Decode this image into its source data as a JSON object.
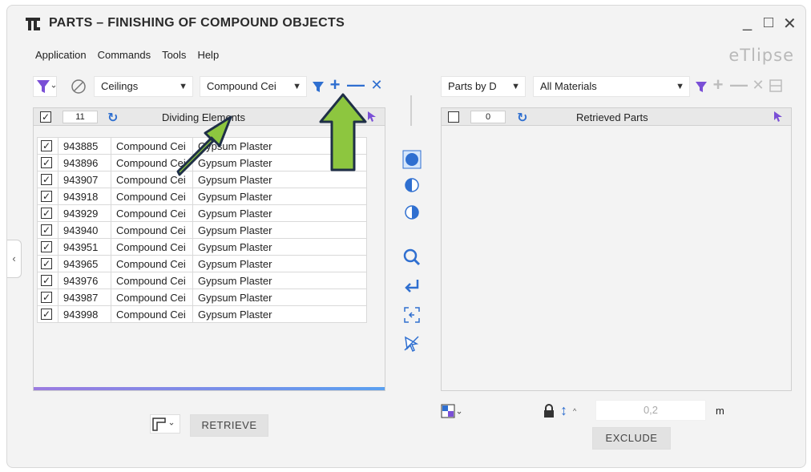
{
  "window": {
    "title": "PARTS – FINISHING OF COMPOUND OBJECTS",
    "brand": "eTlipse"
  },
  "menu": [
    "Application",
    "Commands",
    "Tools",
    "Help"
  ],
  "left": {
    "category": "Ceilings",
    "type_filter": "Compound Cei",
    "header": {
      "count": "11",
      "title": "Dividing Elements"
    },
    "rows": [
      {
        "id": "943885",
        "type": "Compound Cei",
        "material": "Gypsum Plaster"
      },
      {
        "id": "943896",
        "type": "Compound Cei",
        "material": "Gypsum Plaster"
      },
      {
        "id": "943907",
        "type": "Compound Cei",
        "material": "Gypsum Plaster"
      },
      {
        "id": "943918",
        "type": "Compound Cei",
        "material": "Gypsum Plaster"
      },
      {
        "id": "943929",
        "type": "Compound Cei",
        "material": "Gypsum Plaster"
      },
      {
        "id": "943940",
        "type": "Compound Cei",
        "material": "Gypsum Plaster"
      },
      {
        "id": "943951",
        "type": "Compound Cei",
        "material": "Gypsum Plaster"
      },
      {
        "id": "943965",
        "type": "Compound Cei",
        "material": "Gypsum Plaster"
      },
      {
        "id": "943976",
        "type": "Compound Cei",
        "material": "Gypsum Plaster"
      },
      {
        "id": "943987",
        "type": "Compound Cei",
        "material": "Gypsum Plaster"
      },
      {
        "id": "943998",
        "type": "Compound Cei",
        "material": "Gypsum Plaster"
      }
    ],
    "retrieve_label": "RETRIEVE"
  },
  "right": {
    "parts_by": "Parts by D",
    "materials": "All Materials",
    "header": {
      "count": "0",
      "title": "Retrieved Parts"
    },
    "offset_value": "0,2",
    "unit": "m",
    "exclude_label": "EXCLUDE"
  },
  "colors": {
    "accent": "#2f6fd0",
    "filter": "#7a4fd6",
    "arrow": "#8dc63f"
  }
}
